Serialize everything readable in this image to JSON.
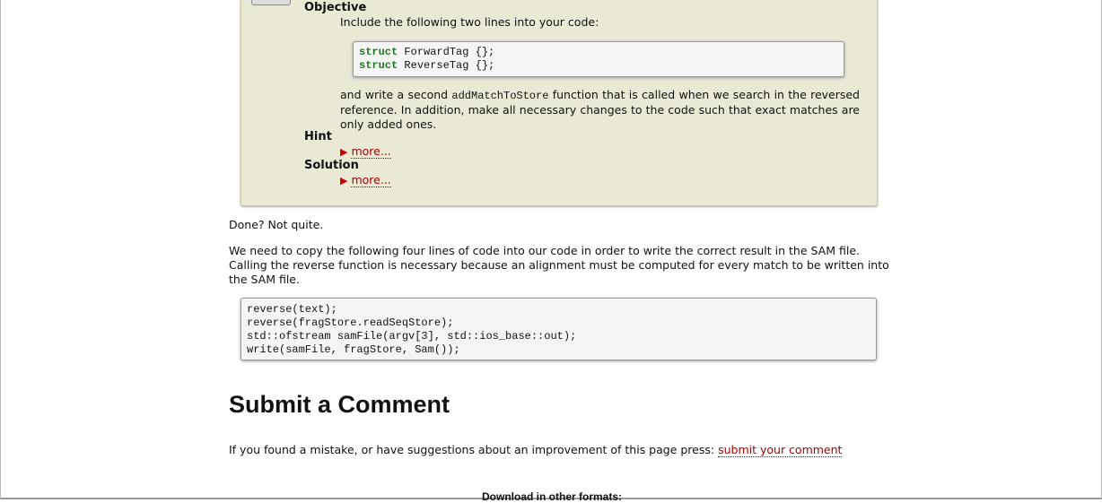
{
  "exercise": {
    "objective_label": "Objective",
    "objective_intro": "Include the following two lines into your code:",
    "code_lines": [
      {
        "kw": "struct",
        "rest": " ForwardTag {};"
      },
      {
        "kw": "struct",
        "rest": " ReverseTag {};"
      }
    ],
    "text_before": "and write a second ",
    "inline_code": "addMatchToStore",
    "text_after": " function that is called when we search in the reversed reference. In addition, make all necessary changes to the code such that exact matches are only added ones.",
    "hint_label": "Hint",
    "solution_label": "Solution",
    "more_label": "more...",
    "triangle_icon": "▶"
  },
  "done_text": "Done? Not quite.",
  "paragraph": "We need to copy the following four lines of code into our code in order to write the correct result in the SAM file. Calling the reverse function is necessary because an alignment must be computed for every match to be written into the SAM file.",
  "code_block": "reverse(text);\nreverse(fragStore.readSeqStore);\nstd::ofstream samFile(argv[3], std::ios_base::out);\nwrite(samFile, fragStore, Sam());",
  "comment": {
    "heading": "Submit a Comment",
    "text": "If you found a mistake, or have suggestions about an improvement of this page press: ",
    "link": "submit your comment"
  },
  "footer": {
    "download_label": "Download in other formats:"
  }
}
